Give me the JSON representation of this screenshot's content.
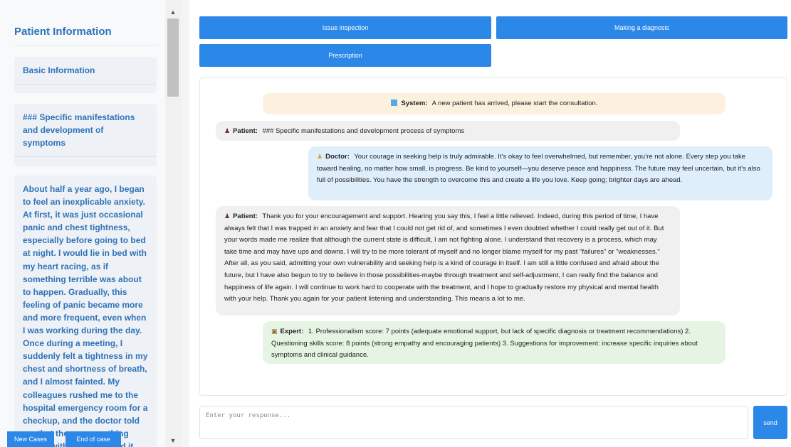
{
  "sidebar": {
    "title": "Patient Information",
    "basic_info": "Basic Information",
    "specific_heading": "### Specific manifestations and development of symptoms",
    "story": "About half a year ago, I began to feel an inexplicable anxiety. At first, it was just occasional panic and chest tightness, especially before going to bed at night. I would lie in bed with my heart racing, as if something terrible was about to happen. Gradually, this feeling of panic became more and more frequent, even when I was working during the day. Once during a meeting, I suddenly felt a tightness in my chest and shortness of breath, and I almost fainted. My colleagues rushed me to the hospital emergency room for a checkup, and the doctor told me that there was nothing wrong with my heart, and it"
  },
  "bottom_buttons": {
    "new_cases": "New Cases",
    "end_case": "End of case"
  },
  "actions": {
    "issue_inspection": "Issue inspection",
    "making_diagnosis": "Making a diagnosis",
    "prescription": "Prescription"
  },
  "chat": {
    "system": {
      "who": "System:",
      "text": "A new patient has arrived, please start the consultation."
    },
    "patient1": {
      "who": "Patient:",
      "text": "### Specific manifestations and development process of symptoms"
    },
    "doctor": {
      "who": "Doctor:",
      "text": "Your courage in seeking help is truly admirable. It’s okay to feel overwhelmed, but remember, you’re not alone. Every step you take toward healing, no matter how small, is progress. Be kind to yourself—you deserve peace and happiness. The future may feel uncertain, but it’s also full of possibilities. You have the strength to overcome this and create a life you love. Keep going; brighter days are ahead."
    },
    "patient2": {
      "who": "Patient:",
      "text": "Thank you for your encouragement and support. Hearing you say this, I feel a little relieved. Indeed, during this period of time, I have always felt that I was trapped in an anxiety and fear that I could not get rid of, and sometimes I even doubted whether I could really get out of it. But your words made me realize that although the current state is difficult, I am not fighting alone. I understand that recovery is a process, which may take time and may have ups and downs. I will try to be more tolerant of myself and no longer blame myself for my past \"failures\" or \"weaknesses.\" After all, as you said, admitting your own vulnerability and seeking help is a kind of courage in itself. I am still a little confused and afraid about the future, but I have also begun to try to believe in those possibilities-maybe through treatment and self-adjustment, I can really find the balance and happiness of life again. I will continue to work hard to cooperate with the treatment, and I hope to gradually restore my physical and mental health with your help. Thank you again for your patient listening and understanding. This means a lot to me."
    },
    "expert": {
      "who": "Expert:",
      "text": "1. Professionalism score: 7 points (adequate emotional support, but lack of specific diagnosis or treatment recommendations) 2. Questioning skills score: 8 points (strong empathy and encouraging patients) 3. Suggestions for improvement: increase specific inquiries about symptoms and clinical guidance."
    }
  },
  "input": {
    "placeholder": "Enter your response...",
    "value": ""
  },
  "send_label": "send",
  "icons": {
    "system": "computer-icon",
    "patient": "person-icon",
    "doctor": "doctor-icon",
    "expert": "expert-badge-icon",
    "scroll_up": "triangle-up-icon",
    "scroll_down": "triangle-down-icon"
  },
  "colors": {
    "accent": "#2b87e8",
    "sidebar_text": "#2f73b8",
    "system_bubble": "#fcf1df",
    "patient_bubble": "#f0f0f0",
    "doctor_bubble": "#dfeefb",
    "expert_bubble": "#e6f4e4"
  }
}
